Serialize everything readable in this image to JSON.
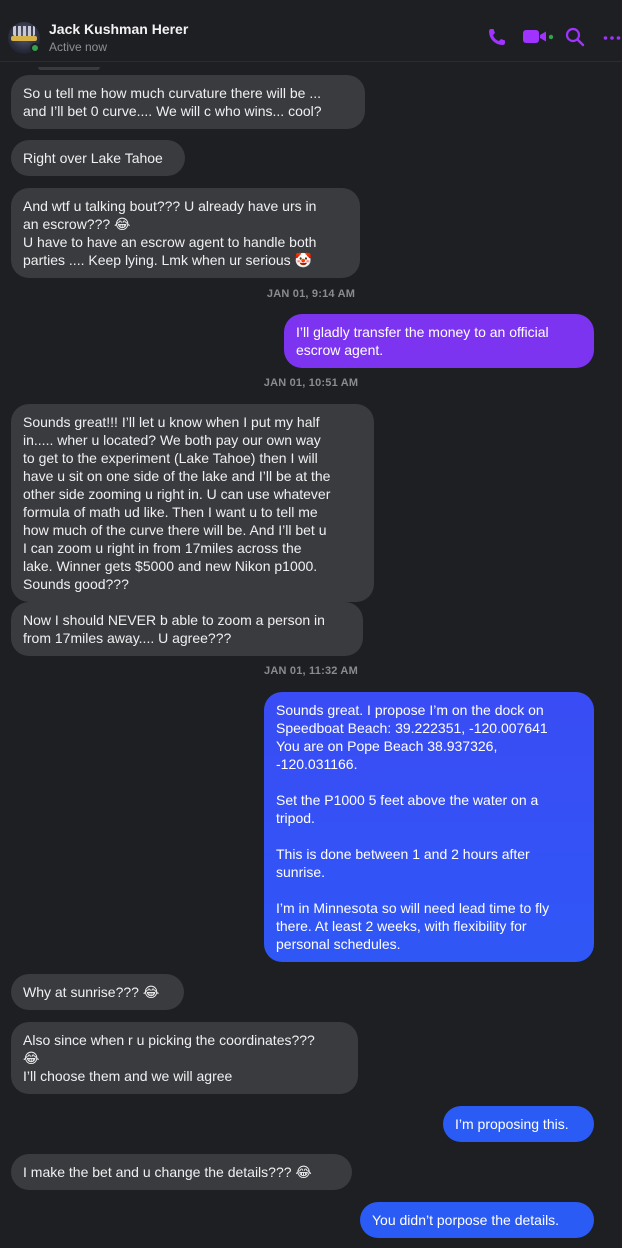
{
  "header": {
    "name": "Jack Kushman Herer",
    "status": "Active now",
    "accent": "#a033ff",
    "icons": [
      "phone-icon",
      "video-camera-icon",
      "search-icon",
      "more-options-icon"
    ]
  },
  "thread": [
    {
      "from": "them",
      "text": "So u tell me how much curvature there will be ...\nand I’ll bet 0 curve.... We will c who wins... cool?"
    },
    {
      "from": "them",
      "text": "Right over Lake Tahoe"
    },
    {
      "from": "them",
      "text": "And wtf u talking bout??? U already have urs in\nan escrow??? 😂\nU have to have an escrow agent to handle both\nparties .... Keep lying. Lmk when ur serious 🤡"
    },
    {
      "from": "timestamp",
      "text": "JAN 01, 9:14 AM"
    },
    {
      "from": "me",
      "text": "I’ll gladly transfer the money to an official\nescrow agent."
    },
    {
      "from": "timestamp",
      "text": "JAN 01, 10:51 AM"
    },
    {
      "from": "them",
      "text": "Sounds great!!! I’ll let u know when I put my half\nin..... wher u located? We both pay our own way\nto get to the experiment (Lake Tahoe) then I will\nhave u sit on one side of the lake and I’ll be at the\nother side zooming u right in. U can use whatever\nformula of math ud like. Then I want u to tell me\nhow much of the curve there will be. And I’ll bet u\nI can zoom u right in from 17miles across the\nlake. Winner gets $5000 and new Nikon p1000.\nSounds good???"
    },
    {
      "from": "them",
      "text": "Now I should NEVER b able to zoom a person in\nfrom 17miles away.... U agree???"
    },
    {
      "from": "timestamp",
      "text": "JAN 01, 11:32 AM"
    },
    {
      "from": "me",
      "text": "Sounds great.  I propose I’m on the dock on\nSpeedboat Beach: 39.222351, -120.007641\nYou are on Pope Beach 38.937326,\n-120.031166.\n\nSet the P1000 5 feet above the water on a\ntripod.\n\nThis is done between 1 and 2 hours after\nsunrise.\n\nI’m in Minnesota so will need lead time to fly\nthere.  At least 2 weeks, with flexibility for\npersonal schedules."
    },
    {
      "from": "them",
      "text": "Why at sunrise??? 😂"
    },
    {
      "from": "them",
      "text": "Also since when r u picking the coordinates???\n😂\nI’ll choose them and we will agree"
    },
    {
      "from": "me",
      "text": "I’m proposing this."
    },
    {
      "from": "them",
      "text": "I make the bet and u change the details??? 😂"
    },
    {
      "from": "me",
      "text": "You didn’t porpose the details."
    }
  ]
}
